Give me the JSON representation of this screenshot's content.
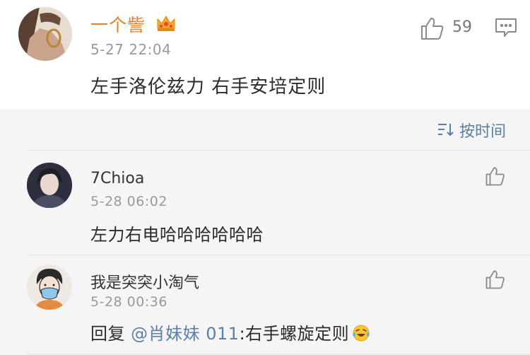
{
  "main_comment": {
    "username": "一个訾",
    "badge_icon": "crown-icon",
    "timestamp": "5-27 22:04",
    "text": "左手洛伦兹力 右手安培定则",
    "like_count": "59",
    "like_icon": "thumbs-up-icon",
    "comment_icon": "comment-icon"
  },
  "replies_section": {
    "sort_label": "按时间",
    "sort_icon": "sort-icon",
    "replies": [
      {
        "username": "7Chioa",
        "timestamp": "5-28 06:02",
        "text": "左力右电哈哈哈哈哈哈"
      },
      {
        "username": "我是突突小淘气",
        "timestamp": "5-28 00:36",
        "reply_prefix": "回复",
        "mention": "@肖妹妹 011",
        "text": ":右手螺旋定则",
        "emoji": "laughing-crying-emoji"
      }
    ]
  },
  "colors": {
    "username_vip": "#f07c22",
    "link": "#5a7fa8",
    "timestamp": "#9a9a9a",
    "panel_background": "#f5f5f5"
  }
}
